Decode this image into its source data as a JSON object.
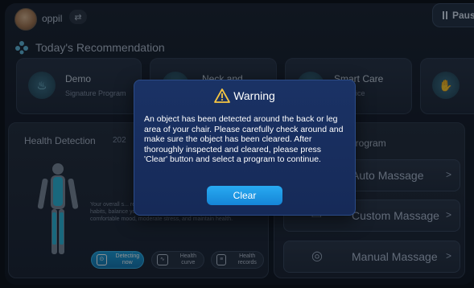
{
  "header": {
    "user_name": "oppil",
    "pause_label": "Paus",
    "recommendation_title": "Today's Recommendation"
  },
  "recommendations": [
    {
      "title": "Demo",
      "subtitle": "Signature Program",
      "icon": "massage-figure-icon"
    },
    {
      "title": "Neck and",
      "subtitle": "",
      "icon": "neck-icon"
    },
    {
      "title": "Smart Care",
      "subtitle": "ar Choice",
      "icon": "smart-care-icon"
    },
    {
      "title": "",
      "subtitle": "",
      "icon": "hands-icon"
    }
  ],
  "health_detection": {
    "title": "Health Detection",
    "date": "202",
    "description": "Your overall s... recommended that you adhere to good lifestyle habits, balance your diet, sleep reasonably, maintain a comfortable mood, moderate stress, and maintain health.",
    "buttons": [
      {
        "label": "Detecting now",
        "icon": "detect-icon",
        "active": true
      },
      {
        "label": "Health curve",
        "icon": "curve-icon",
        "active": false
      },
      {
        "label": "Health records",
        "icon": "records-icon",
        "active": false
      }
    ]
  },
  "massage_program": {
    "title": "e program",
    "options": [
      {
        "label": "Auto Massage",
        "icon": "auto-icon"
      },
      {
        "label": "Custom Massage",
        "icon": "custom-icon"
      },
      {
        "label": "Manual Massage",
        "icon": "manual-icon"
      }
    ]
  },
  "dialog": {
    "title": "Warning",
    "message": "An object has been detected around the back or leg area of your chair. Please carefully check around and make sure the object has been cleared. After thoroughly inspected and cleared, please press 'Clear' button and select a program to continue.",
    "button_label": "Clear"
  },
  "colors": {
    "accent": "#1a9cd8",
    "dialog_bg": "#1a3265",
    "warning_icon": "#f5c542"
  }
}
